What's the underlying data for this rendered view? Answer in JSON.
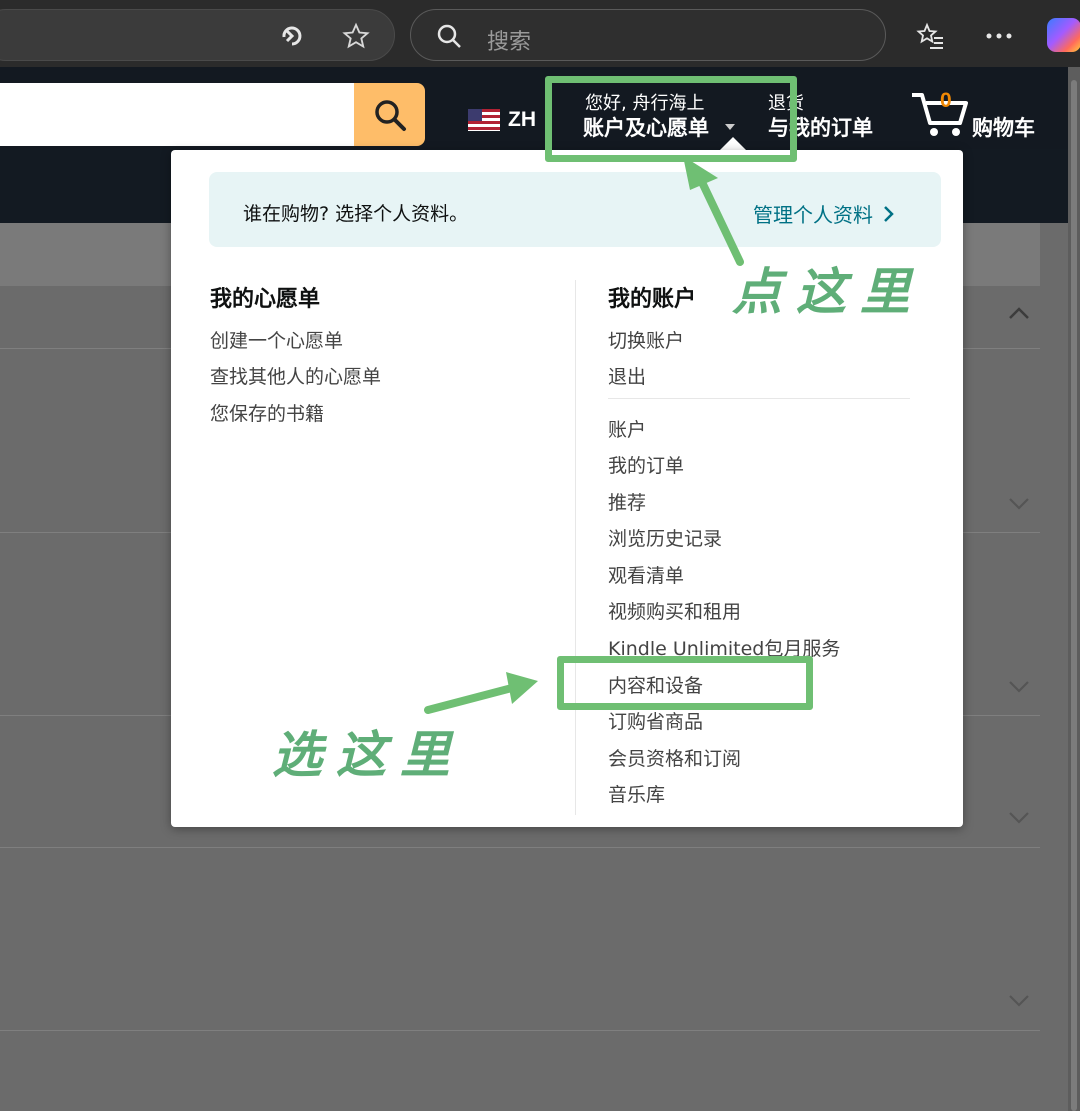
{
  "browser": {
    "search_placeholder": "搜索",
    "icons": [
      "refresh-icon",
      "favorite-star-icon",
      "search-icon",
      "favorites-list-icon",
      "more-icon",
      "copilot-icon"
    ]
  },
  "header": {
    "language": "ZH",
    "greeting": "您好, 舟行海上",
    "account_label": "账户及心愿单",
    "returns_top": "退货",
    "returns_main": "与我的订单",
    "cart_count": "0",
    "cart_label": "购物车"
  },
  "flyout": {
    "profile_question": "谁在购物?  选择个人资料。",
    "profile_manage": "管理个人资料",
    "wishlist": {
      "heading": "我的心愿单",
      "items": [
        "创建一个心愿单",
        "查找其他人的心愿单",
        "您保存的书籍"
      ]
    },
    "account": {
      "heading": "我的账户",
      "top_items": [
        "切换账户",
        "退出"
      ],
      "items": [
        "账户",
        "我的订单",
        "推荐",
        "浏览历史记录",
        "观看清单",
        "视频购买和租用",
        "Kindle Unlimited包月服务",
        "内容和设备",
        "订购省商品",
        "会员资格和订阅",
        "音乐库"
      ]
    }
  },
  "annotations": {
    "click_here": "点这里",
    "select_here": "选这里",
    "color": "#6fbf73"
  }
}
